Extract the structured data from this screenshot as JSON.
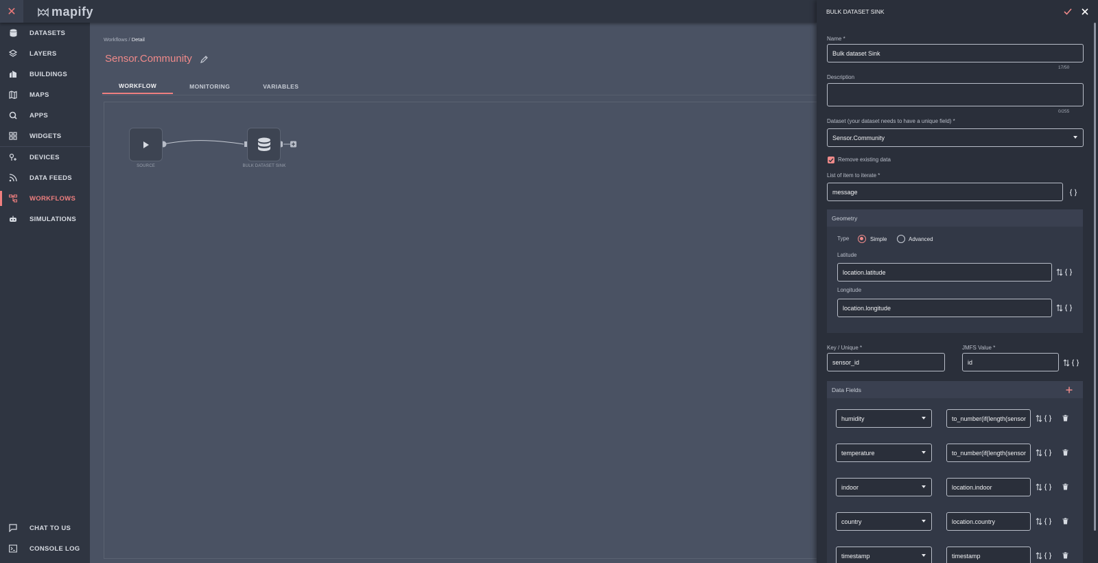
{
  "app": {
    "logo_text": "mapify"
  },
  "nav": {
    "items": [
      {
        "label": "DATASETS",
        "icon": "database-icon"
      },
      {
        "label": "LAYERS",
        "icon": "layers-icon"
      },
      {
        "label": "BUILDINGS",
        "icon": "building-icon"
      },
      {
        "label": "MAPS",
        "icon": "map-icon"
      },
      {
        "label": "APPS",
        "icon": "apps-icon"
      },
      {
        "label": "WIDGETS",
        "icon": "widgets-icon"
      },
      {
        "label": "DEVICES",
        "icon": "devices-icon"
      },
      {
        "label": "DATA FEEDS",
        "icon": "rss-icon"
      },
      {
        "label": "WORKFLOWS",
        "icon": "workflow-icon"
      },
      {
        "label": "SIMULATIONS",
        "icon": "simulation-icon"
      }
    ],
    "bottom": [
      {
        "label": "CHAT TO US",
        "icon": "chat-icon"
      },
      {
        "label": "CONSOLE LOG",
        "icon": "console-icon"
      }
    ],
    "accent": "#ef7f7f"
  },
  "breadcrumb": {
    "parent": "Workflows",
    "separator": " / ",
    "current": "Detail"
  },
  "page": {
    "title": "Sensor.Community"
  },
  "tabs": [
    "WORKFLOW",
    "MONITORING",
    "VARIABLES"
  ],
  "canvas": {
    "nodes": [
      {
        "label": "SOURCE",
        "icon": "play-icon"
      },
      {
        "label": "BULK DATASET SINK",
        "icon": "database-icon"
      }
    ]
  },
  "panel": {
    "title": "BULK DATASET SINK",
    "name": {
      "label": "Name *",
      "value": "Bulk dataset Sink",
      "counter": "17/50"
    },
    "description": {
      "label": "Description",
      "value": "",
      "counter": "0/255"
    },
    "dataset": {
      "label": "Dataset (your dataset needs to have a unique field) *",
      "value": "Sensor.Community"
    },
    "remove_existing": {
      "label": "Remove existing data",
      "checked": true
    },
    "iterate": {
      "label": "List of item to iterate *",
      "value": "message"
    },
    "geometry": {
      "title": "Geometry",
      "type_label": "Type",
      "options": [
        "Simple",
        "Advanced"
      ],
      "selected": "Simple",
      "latitude": {
        "label": "Latitude",
        "value": "location.latitude"
      },
      "longitude": {
        "label": "Longitude",
        "value": "location.longitude"
      }
    },
    "key": {
      "label": "Key / Unique *",
      "value": "sensor_id"
    },
    "jmfs": {
      "label": "JMFS Value *",
      "value": "id"
    },
    "data_fields": {
      "title": "Data Fields",
      "rows": [
        {
          "field": "humidity",
          "value": "to_number(if(length(sensor"
        },
        {
          "field": "temperature",
          "value": "to_number(if(length(sensor"
        },
        {
          "field": "indoor",
          "value": "location.indoor"
        },
        {
          "field": "country",
          "value": "location.country"
        },
        {
          "field": "timestamp",
          "value": "timestamp"
        }
      ]
    }
  }
}
